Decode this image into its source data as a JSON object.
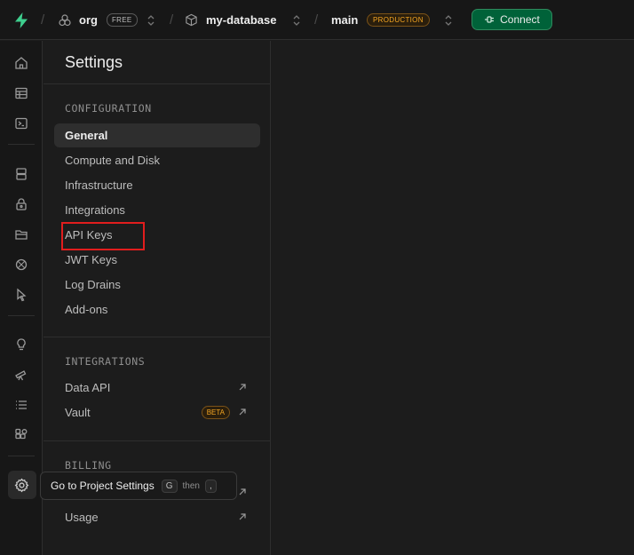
{
  "topbar": {
    "org": "org",
    "org_plan": "FREE",
    "project": "my-database",
    "branch": "main",
    "branch_env": "PRODUCTION",
    "connect_label": "Connect"
  },
  "rail": {
    "icons": [
      "home-icon",
      "table-editor-icon",
      "sql-editor-icon",
      "database-icon",
      "auth-icon",
      "storage-icon",
      "edge-functions-icon",
      "realtime-icon",
      "advisors-icon",
      "observability-icon",
      "logs-icon",
      "integrations-icon",
      "settings-icon"
    ]
  },
  "settings": {
    "title": "Settings",
    "configuration": {
      "heading": "CONFIGURATION",
      "items": [
        "General",
        "Compute and Disk",
        "Infrastructure",
        "Integrations",
        "API Keys",
        "JWT Keys",
        "Log Drains",
        "Add-ons"
      ]
    },
    "integrations": {
      "heading": "INTEGRATIONS",
      "items": [
        "Data API",
        "Vault"
      ],
      "vault_badge": "BETA"
    },
    "billing": {
      "heading": "BILLING",
      "items": [
        "Usage"
      ]
    }
  },
  "tooltip": {
    "text": "Go to Project Settings",
    "key1": "G",
    "then": "then",
    "key2": ","
  },
  "colors": {
    "accent_green": "#006239",
    "production_orange": "#f5a623",
    "highlight_red": "#e11d1d"
  }
}
